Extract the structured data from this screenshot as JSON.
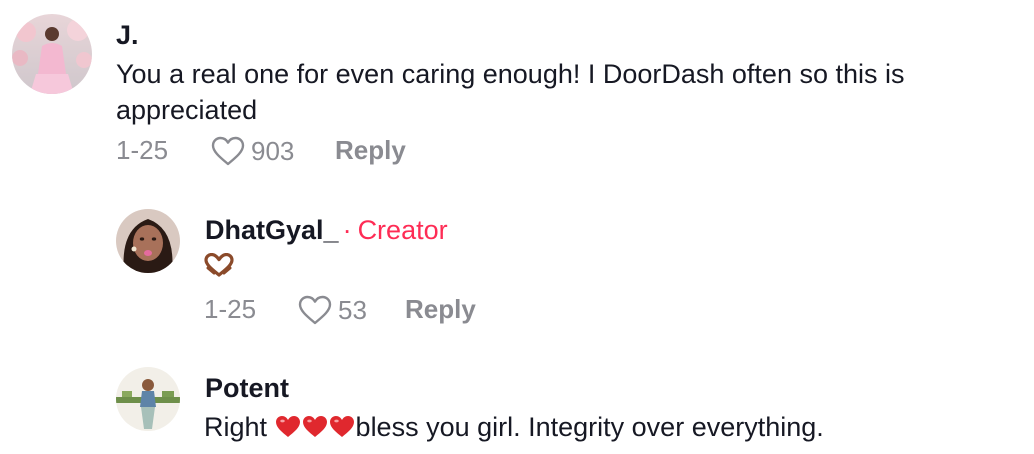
{
  "comments": [
    {
      "username": "J.",
      "text_line1": "You a real one for even caring enough! I DoorDash often so this is",
      "text_line2": "appreciated",
      "date": "1-25",
      "likes": "903",
      "reply_label": "Reply"
    },
    {
      "username": "DhatGyal_",
      "creator_separator": "·",
      "creator_label": "Creator",
      "text_icon": "heart-hands-icon",
      "date": "1-25",
      "likes": "53",
      "reply_label": "Reply"
    },
    {
      "username": "Potent",
      "text_prefix": "Right ",
      "text_icons": [
        "red-heart-icon",
        "red-heart-icon",
        "red-heart-icon"
      ],
      "text_suffix": "bless you girl. Integrity over everything."
    }
  ],
  "colors": {
    "text": "#161823",
    "secondary": "#8a8b91",
    "creator": "#fe2c55",
    "heart_emoji": "#e0282e"
  }
}
